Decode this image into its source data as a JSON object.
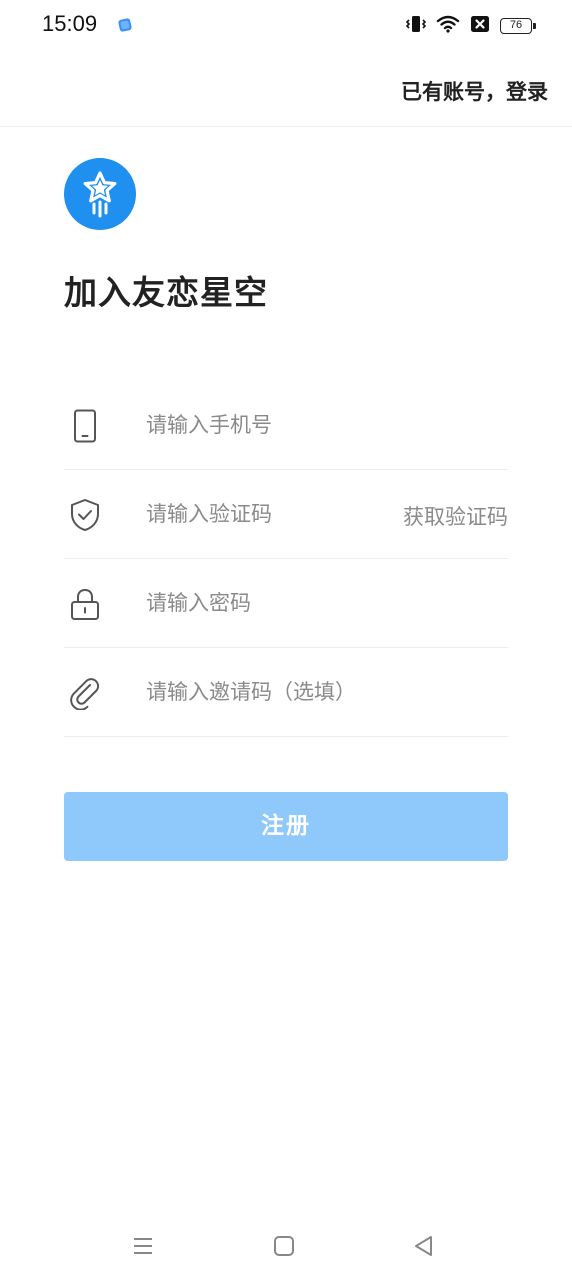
{
  "status_bar": {
    "time": "15:09",
    "battery": "76",
    "icons": [
      "app-notification-icon",
      "vibrate-icon",
      "wifi-icon",
      "sim-blocked-icon",
      "battery-icon"
    ]
  },
  "header": {
    "login_link": "已有账号，登录"
  },
  "logo": {
    "icon": "star-rocket-logo-icon",
    "color": "#1f8ff0"
  },
  "title": "加入友恋星空",
  "form": {
    "phone": {
      "icon": "phone-icon",
      "placeholder": "请输入手机号",
      "value": ""
    },
    "code": {
      "icon": "shield-check-icon",
      "placeholder": "请输入验证码",
      "value": "",
      "get_code_label": "获取验证码"
    },
    "password": {
      "icon": "lock-icon",
      "placeholder": "请输入密码",
      "value": ""
    },
    "invite": {
      "icon": "paperclip-icon",
      "placeholder": "请输入邀请码（选填）",
      "value": ""
    }
  },
  "register_button": {
    "label": "注册",
    "color": "#8fc8fb"
  },
  "nav_bar": {
    "icons": [
      "menu-icon",
      "home-icon",
      "back-icon"
    ]
  }
}
